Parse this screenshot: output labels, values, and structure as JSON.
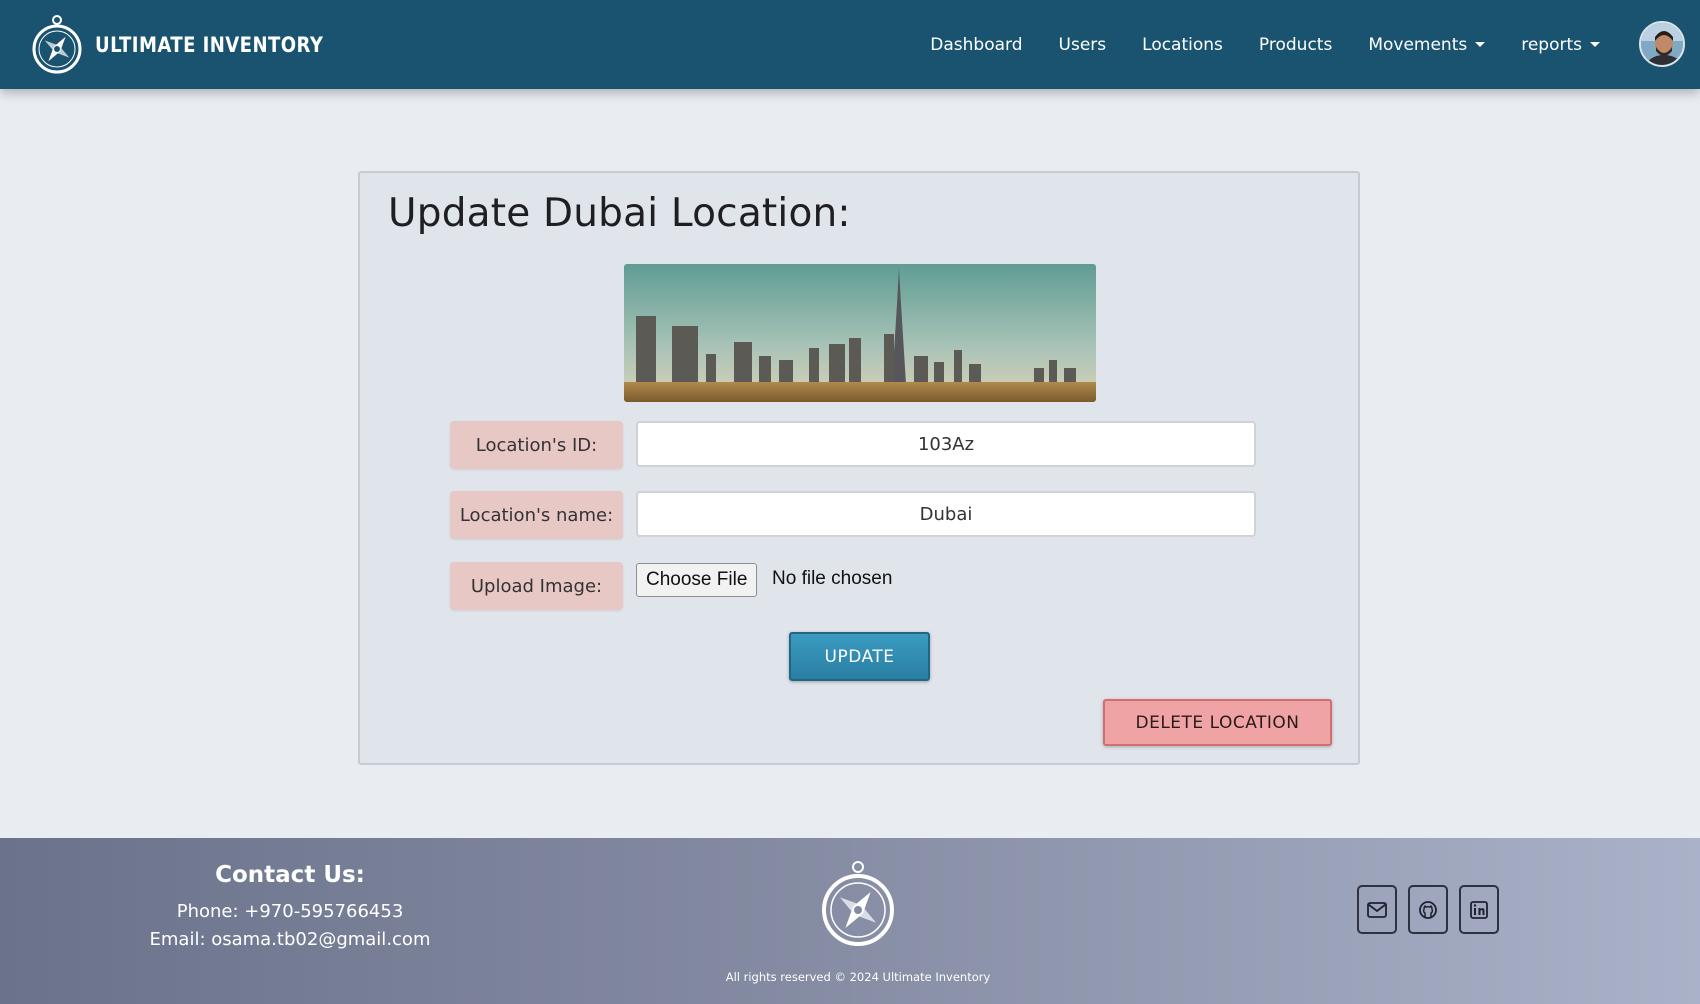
{
  "navbar": {
    "brand": "ULTIMATE INVENTORY",
    "links": [
      {
        "label": "Dashboard"
      },
      {
        "label": "Users"
      },
      {
        "label": "Locations"
      },
      {
        "label": "Products"
      },
      {
        "label": "Movements",
        "dropdown": true
      },
      {
        "label": "reports",
        "dropdown": true
      }
    ],
    "avatar_icon": "user-avatar"
  },
  "page": {
    "title": "Update Dubai Location:",
    "image_icon": "dubai-skyline-image",
    "form": {
      "id_label": "Location's ID:",
      "id_value": "103Az",
      "name_label": "Location's name:",
      "name_value": "Dubai",
      "upload_label": "Upload Image:",
      "choose_file_label": "Choose File",
      "file_status": "No file chosen"
    },
    "update_label": "UPDATE",
    "delete_label": "DELETE LOCATION"
  },
  "footer": {
    "contact_title": "Contact Us:",
    "phone": "Phone: +970-595766453",
    "email": "Email: osama.tb02@gmail.com",
    "copyright": "All rights reserved © 2024 Ultimate Inventory",
    "social": [
      "mail-icon",
      "github-icon",
      "linkedin-icon"
    ]
  },
  "colors": {
    "navbar": "#1a536f",
    "update_button": "#2a7fa3",
    "delete_button": "#f0a3a4",
    "label_bg": "#e8c8c4"
  }
}
